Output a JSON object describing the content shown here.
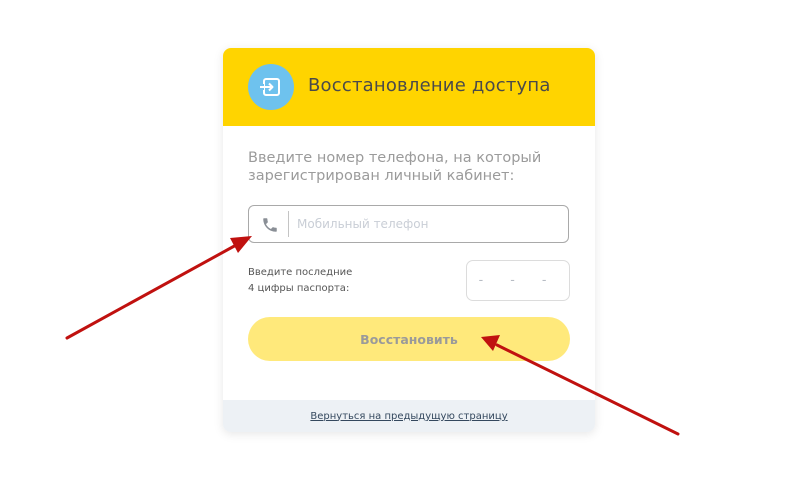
{
  "header": {
    "title": "Восстановление доступа",
    "icon": "sign-in-icon",
    "accent_color": "#ffd400",
    "icon_bg_color": "#6ec2ee"
  },
  "intro_text": "Введите номер телефона, на который зарегистрирован личный кабинет:",
  "phone": {
    "icon": "phone-icon",
    "placeholder": "Мобильный телефон",
    "value": ""
  },
  "passport": {
    "label_line1": "Введите последние",
    "label_line2": "4 цифры паспорта:",
    "placeholder": "- - - -",
    "value": ""
  },
  "submit": {
    "label": "Восстановить",
    "color": "#ffe97b"
  },
  "footer": {
    "back_link": "Вернуться на предыдущую страницу"
  },
  "annotations": {
    "arrow_color": "#c0110f"
  }
}
